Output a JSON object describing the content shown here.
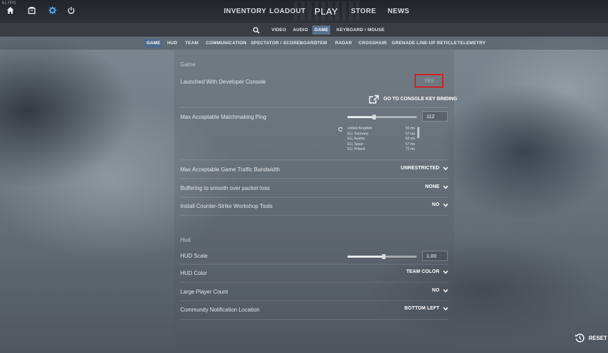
{
  "fps": "61 FPS",
  "topbar": {
    "icons": [
      "home-icon",
      "inventory-box-icon",
      "settings-gear-icon",
      "power-icon"
    ],
    "nav": {
      "inventory": "INVENTORY",
      "loadout": "LOADOUT",
      "play": "PLAY",
      "store": "STORE",
      "news": "NEWS"
    }
  },
  "settings_nav": {
    "search_icon": "search-icon",
    "items": {
      "video": "VIDEO",
      "audio": "AUDIO",
      "game": "GAME",
      "keyboard": "KEYBOARD / MOUSE"
    },
    "active": "GAME"
  },
  "tabs": {
    "game": "GAME",
    "hud": "HUD",
    "team": "TEAM",
    "communication": "COMMUNICATION",
    "spectator": "SPECTATOR / SCOREBOARD",
    "item": "ITEM",
    "radar": "RADAR",
    "crosshair": "CROSSHAIR",
    "grenade": "GRENADE LINE-UP RETICLE",
    "telemetry": "TELEMETRY",
    "active": "GAME"
  },
  "game_section": {
    "title": "Game",
    "dev_console": {
      "label": "Launched With Developer Console",
      "value": "YES"
    },
    "console_key_link": "GO TO CONSOLE KEY BINDING",
    "max_ping": {
      "label": "Max Acceptable Matchmaking Ping",
      "value": "112",
      "slider_fraction": 0.38
    },
    "ping_regions": [
      {
        "region": "United Kingdom",
        "ms": "55 ms"
      },
      {
        "region": "EU, Germany",
        "ms": "57 ms"
      },
      {
        "region": "EU, Austria",
        "ms": "62 ms"
      },
      {
        "region": "EU, Spain",
        "ms": "67 ms"
      },
      {
        "region": "EU, Poland",
        "ms": "72 ms"
      }
    ],
    "bandwidth": {
      "label": "Max Acceptable Game Traffic Bandwidth",
      "value": "UNRESTRICTED"
    },
    "buffering": {
      "label": "Buffering to smooth over packet loss",
      "value": "NONE"
    },
    "workshop": {
      "label": "Install Counter-Strike Workshop Tools",
      "value": "NO"
    }
  },
  "hud_section": {
    "title": "Hud",
    "scale": {
      "label": "HUD Scale",
      "value": "1.00",
      "slider_fraction": 0.52
    },
    "color": {
      "label": "HUD Color",
      "value": "TEAM COLOR"
    },
    "large_player_count": {
      "label": "Large Player Count",
      "value": "NO"
    },
    "notification_location": {
      "label": "Community Notification Location",
      "value": "BOTTOM LEFT"
    }
  },
  "reset_label": "RESET",
  "colors": {
    "highlight_box": "#d2211f",
    "active_tab": "#4c6a89",
    "active_nav": "#58728c"
  }
}
